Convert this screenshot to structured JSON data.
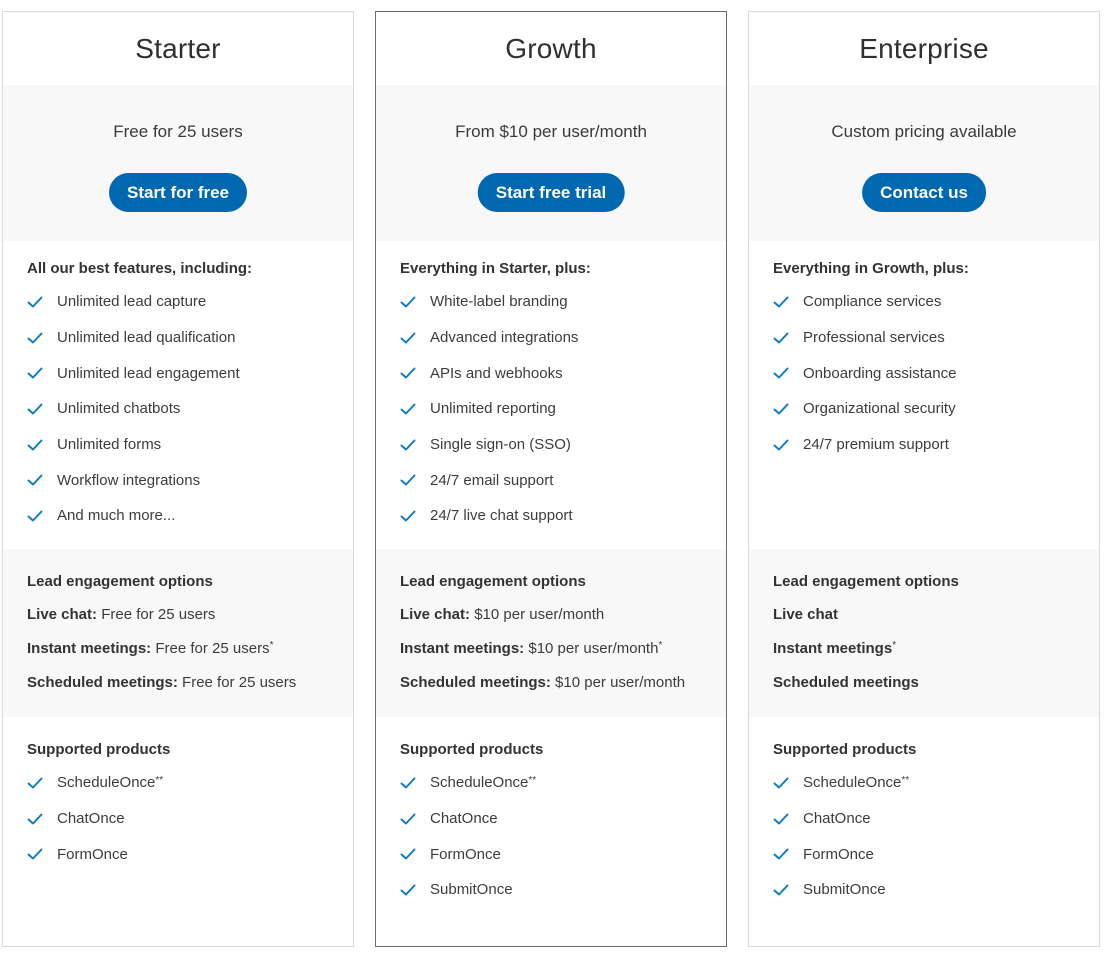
{
  "colors": {
    "accent": "#0067b1",
    "check": "#0f7cc4",
    "band_background": "#f8f8f8",
    "featured_border": "#6b6b6b",
    "card_border": "#d7dadd"
  },
  "plans": [
    {
      "name": "Starter",
      "price": "Free for 25 users",
      "cta": "Start for free",
      "features_heading": "All our best features, including:",
      "features": [
        "Unlimited lead capture",
        "Unlimited lead qualification",
        "Unlimited lead engagement",
        "Unlimited chatbots",
        "Unlimited forms",
        "Workflow integrations",
        "And much more..."
      ],
      "engagement_heading": "Lead engagement options",
      "engagement": [
        {
          "label": "Live chat:",
          "value": " Free for 25 users",
          "mark": ""
        },
        {
          "label": "Instant meetings:",
          "value": " Free for 25 users",
          "mark": "*"
        },
        {
          "label": "Scheduled meetings:",
          "value": " Free for 25 users",
          "mark": ""
        }
      ],
      "products_heading": "Supported products",
      "products": [
        {
          "name": "ScheduleOnce",
          "mark": "**"
        },
        {
          "name": "ChatOnce",
          "mark": ""
        },
        {
          "name": "FormOnce",
          "mark": ""
        }
      ]
    },
    {
      "name": "Growth",
      "price": "From $10 per user/month",
      "cta": "Start free trial",
      "features_heading": "Everything in Starter, plus:",
      "features": [
        "White-label branding",
        "Advanced integrations",
        "APIs and webhooks",
        "Unlimited reporting",
        "Single sign-on (SSO)",
        "24/7 email support",
        "24/7 live chat support"
      ],
      "engagement_heading": "Lead engagement options",
      "engagement": [
        {
          "label": "Live chat:",
          "value": " $10 per user/month",
          "mark": ""
        },
        {
          "label": "Instant meetings:",
          "value": " $10 per user/month",
          "mark": "*"
        },
        {
          "label": "Scheduled meetings:",
          "value": " $10 per user/month",
          "mark": ""
        }
      ],
      "products_heading": "Supported products",
      "products": [
        {
          "name": "ScheduleOnce",
          "mark": "**"
        },
        {
          "name": "ChatOnce",
          "mark": ""
        },
        {
          "name": "FormOnce",
          "mark": ""
        },
        {
          "name": "SubmitOnce",
          "mark": ""
        }
      ]
    },
    {
      "name": "Enterprise",
      "price": "Custom pricing available",
      "cta": "Contact us",
      "features_heading": "Everything in Growth, plus:",
      "features": [
        "Compliance services",
        "Professional services",
        "Onboarding assistance",
        "Organizational security",
        "24/7 premium support"
      ],
      "engagement_heading": "Lead engagement options",
      "engagement": [
        {
          "label": "Live chat",
          "value": "",
          "mark": ""
        },
        {
          "label": "Instant meetings",
          "value": "",
          "mark": "*"
        },
        {
          "label": "Scheduled meetings",
          "value": "",
          "mark": ""
        }
      ],
      "products_heading": "Supported products",
      "products": [
        {
          "name": "ScheduleOnce",
          "mark": "**"
        },
        {
          "name": "ChatOnce",
          "mark": ""
        },
        {
          "name": "FormOnce",
          "mark": ""
        },
        {
          "name": "SubmitOnce",
          "mark": ""
        }
      ]
    }
  ]
}
